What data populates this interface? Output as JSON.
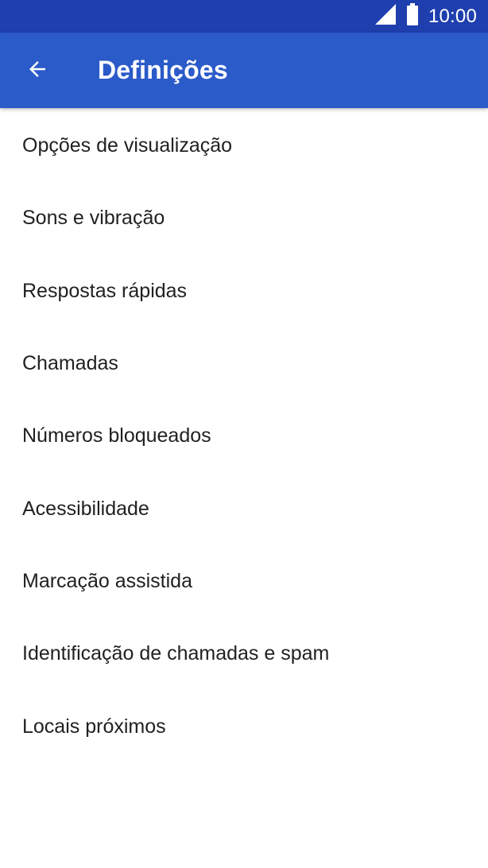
{
  "status_bar": {
    "time": "10:00",
    "icons": [
      "signal-icon",
      "battery-icon"
    ]
  },
  "app_bar": {
    "title": "Definições",
    "back_icon": "arrow-back-icon"
  },
  "colors": {
    "status_bar": "#1f3fae",
    "app_bar": "#2b5ac9",
    "text_primary": "#212121",
    "background": "#ffffff"
  },
  "settings": {
    "items": [
      {
        "label": "Opções de visualização"
      },
      {
        "label": "Sons e vibração"
      },
      {
        "label": "Respostas rápidas"
      },
      {
        "label": "Chamadas"
      },
      {
        "label": "Números bloqueados"
      },
      {
        "label": "Acessibilidade"
      },
      {
        "label": "Marcação assistida"
      },
      {
        "label": "Identificação de chamadas e spam"
      },
      {
        "label": "Locais próximos"
      }
    ]
  }
}
